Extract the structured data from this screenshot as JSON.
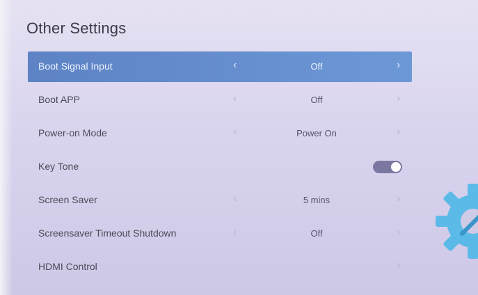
{
  "page": {
    "title": "Other Settings"
  },
  "settings": [
    {
      "label": "Boot Signal Input",
      "value": "Off",
      "selected": true
    },
    {
      "label": "Boot APP",
      "value": "Off"
    },
    {
      "label": "Power-on Mode",
      "value": "Power On"
    },
    {
      "label": "Key Tone",
      "toggle_on": true
    },
    {
      "label": "Screen Saver",
      "value": "5 mins"
    },
    {
      "label": "Screensaver Timeout Shutdown",
      "value": "Off"
    },
    {
      "label": "HDMI Control",
      "value": ""
    }
  ],
  "icons": {
    "chevron_left": "chevron-left-icon",
    "chevron_right": "chevron-right-icon",
    "decorative_gear": "gear-icon"
  },
  "colors": {
    "selected_row": "#6d98d6",
    "toggle_on": "#7a78a0",
    "gear": "#4fb8e8"
  }
}
